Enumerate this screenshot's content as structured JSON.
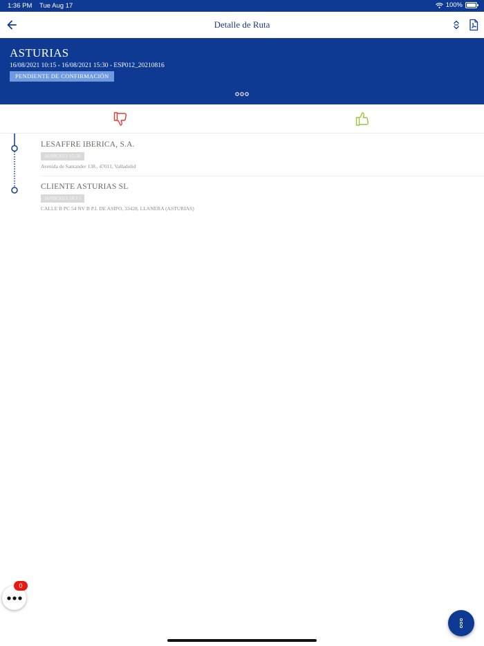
{
  "status_bar": {
    "time": "1:36 PM",
    "date": "Tue Aug 17",
    "battery_percent": "100%",
    "battery_level": 1.0
  },
  "nav": {
    "title": "Detalle de Ruta",
    "back_icon": "arrow-left-icon",
    "sort_icon": "sort-icon",
    "pdf_icon": "pdf-icon"
  },
  "route": {
    "name": "ASTURIAS",
    "info": "16/08/2021 10:15 - 16/08/2021 15:30 - ESP012_20210816",
    "status": "PENDIENTE DE CONFIRMACIÓN"
  },
  "actions": {
    "reject_icon": "thumbs-down-icon",
    "accept_icon": "thumbs-up-icon",
    "reject_color": "#e53935",
    "accept_color": "#9bc53d"
  },
  "stops": [
    {
      "name": "LESAFFRE IBERICA, S.A.",
      "time": "16/08/2021 15:30",
      "address": "Avenida de Santander 138., 47011, Valladolid"
    },
    {
      "name": "CLIENTE ASTURIAS SL",
      "time": "16/08/2021 18:15",
      "address": "CALLE B PC 54 NV B P.I. DE ASIPO, 33428, LLANERA (ASTURIAS)"
    }
  ],
  "fab": {
    "badge_count": "0",
    "left_icon": "more-horizontal-icon",
    "right_icon": "more-vertical-icon"
  },
  "colors": {
    "brand": "#0e3a93",
    "badge": "#6f9ae0",
    "notification": "#e8190f"
  }
}
